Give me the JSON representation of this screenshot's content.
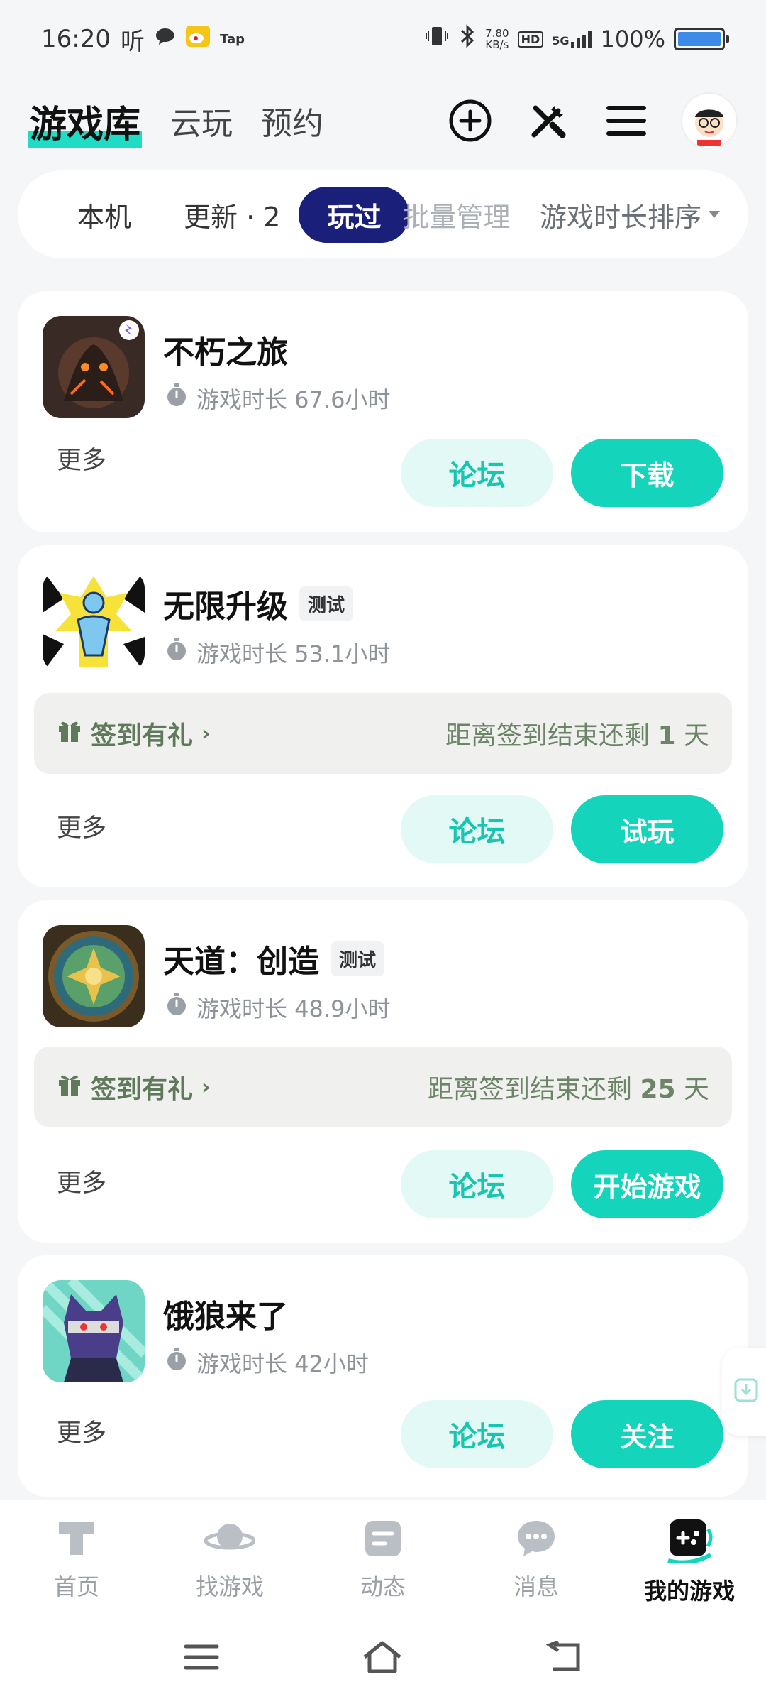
{
  "status_bar": {
    "time": "16:20",
    "ting": "听",
    "tap": "Tap",
    "net_speed_value": "7.80",
    "net_speed_unit": "KB/s",
    "hd": "HD",
    "signal": "5G",
    "battery": "100%",
    "battery_color": "#3c8ce7"
  },
  "header": {
    "title": "游戏库",
    "tabs": [
      "云玩",
      "预约"
    ],
    "accent": "#1fdcc4"
  },
  "filters": {
    "local": "本机",
    "update": "更新 · 2",
    "played": "玩过",
    "batch": "批量管理",
    "sort": "游戏时长排序"
  },
  "games": [
    {
      "name": "不朽之旅",
      "tag": "",
      "playtime": "游戏时长 67.6小时",
      "more": "更多",
      "forum": "论坛",
      "action": "下载",
      "icon": "volcano-monster-icon"
    },
    {
      "name": "无限升级",
      "tag": "测试",
      "playtime": "游戏时长 53.1小时",
      "checkin_label": "签到有礼",
      "checkin_remaining_pre": "距离签到结束还剩 ",
      "checkin_remaining_num": "1",
      "checkin_remaining_post": " 天",
      "more": "更多",
      "forum": "论坛",
      "action": "试玩",
      "icon": "blue-figure-icon"
    },
    {
      "name": "天道：创造",
      "tag": "测试",
      "playtime": "游戏时长 48.9小时",
      "checkin_label": "签到有礼",
      "checkin_remaining_pre": "距离签到结束还剩 ",
      "checkin_remaining_num": "25",
      "checkin_remaining_post": " 天",
      "more": "更多",
      "forum": "论坛",
      "action": "开始游戏",
      "icon": "mandala-icon"
    },
    {
      "name": "饿狼来了",
      "tag": "",
      "playtime": "游戏时长 42小时",
      "more": "更多",
      "forum": "论坛",
      "action": "关注",
      "icon": "wolf-ninja-icon"
    }
  ],
  "bottom_nav": [
    {
      "label": "首页",
      "icon": "home-t-icon"
    },
    {
      "label": "找游戏",
      "icon": "planet-icon"
    },
    {
      "label": "动态",
      "icon": "feed-icon"
    },
    {
      "label": "消息",
      "icon": "chat-icon"
    },
    {
      "label": "我的游戏",
      "icon": "gamepad-icon",
      "active": true
    }
  ],
  "colors": {
    "primary_button": "#14d4bc",
    "forum_button_bg": "#e3f9f6",
    "active_filter": "#1a1f7a"
  }
}
